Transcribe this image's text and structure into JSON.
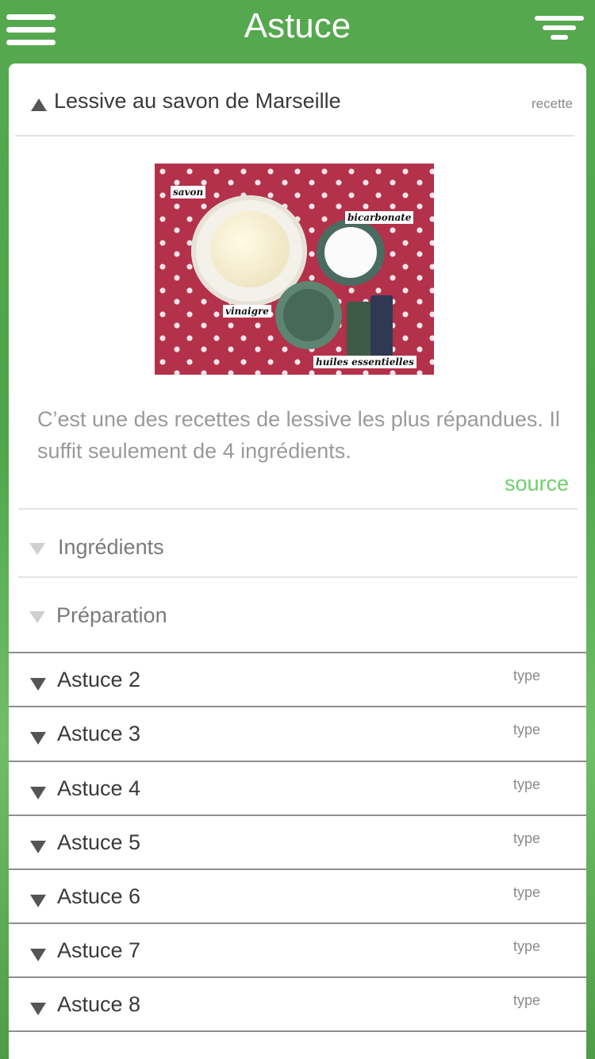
{
  "header": {
    "title": "Astuce"
  },
  "card": {
    "title": "Lessive au savon de Marseille",
    "tag": "recette",
    "image": {
      "labels": [
        "savon",
        "bicarbonate",
        "vinaigre",
        "huiles essentielles"
      ]
    },
    "description": "C’est une des recettes de lessive les plus répandues. Il suffit seulement de 4 ingrédients.",
    "source_label": "source",
    "sections": [
      {
        "label": "Ingrédients"
      },
      {
        "label": "Préparation"
      }
    ]
  },
  "list": [
    {
      "label": "Astuce 2",
      "type": "type"
    },
    {
      "label": "Astuce 3",
      "type": "type"
    },
    {
      "label": "Astuce 4",
      "type": "type"
    },
    {
      "label": "Astuce 5",
      "type": "type"
    },
    {
      "label": "Astuce 6",
      "type": "type"
    },
    {
      "label": "Astuce 7",
      "type": "type"
    },
    {
      "label": "Astuce 8",
      "type": "type"
    }
  ],
  "colors": {
    "brand_green": "#55a84e",
    "source_green": "#6fcf6a"
  },
  "icons": {
    "menu": "hamburger-menu-icon",
    "filter": "filter-icon",
    "expanded": "triangle-up-icon",
    "collapsed": "triangle-down-icon"
  }
}
